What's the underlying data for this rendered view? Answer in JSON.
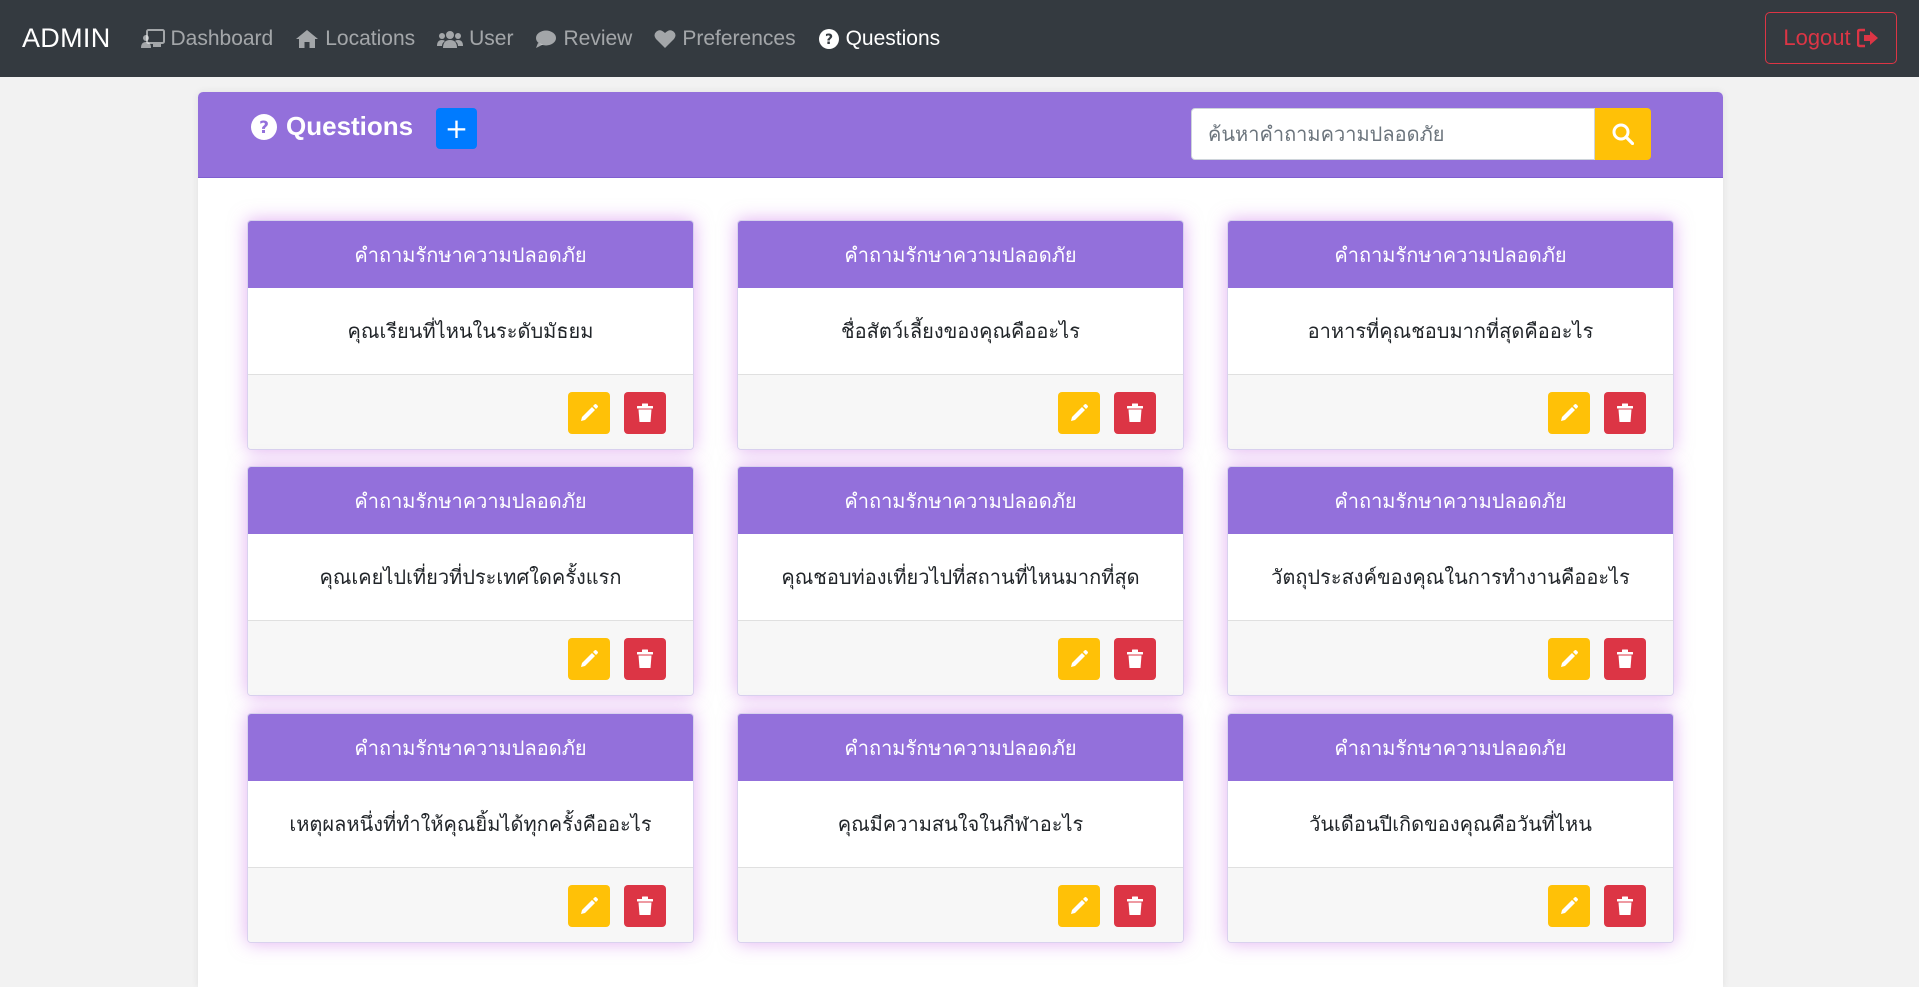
{
  "navbar": {
    "brand": "ADMIN",
    "items": [
      {
        "label": "Dashboard",
        "icon": "chalkboard-teacher-icon"
      },
      {
        "label": "Locations",
        "icon": "home-icon"
      },
      {
        "label": "User",
        "icon": "users-icon"
      },
      {
        "label": "Review",
        "icon": "comment-icon"
      },
      {
        "label": "Preferences",
        "icon": "heart-icon"
      },
      {
        "label": "Questions",
        "icon": "question-circle-icon",
        "active": true
      }
    ],
    "logout_label": "Logout"
  },
  "panel": {
    "title": "Questions",
    "add_label": "+",
    "search_placeholder": "ค้นหาคำถามความปลอดภัย"
  },
  "cards": [
    {
      "header": "คำถามรักษาความปลอดภัย",
      "question": "คุณเรียนที่ไหนในระดับมัธยม"
    },
    {
      "header": "คำถามรักษาความปลอดภัย",
      "question": "ชื่อสัตว์เลี้ยงของคุณคืออะไร"
    },
    {
      "header": "คำถามรักษาความปลอดภัย",
      "question": "อาหารที่คุณชอบมากที่สุดคืออะไร"
    },
    {
      "header": "คำถามรักษาความปลอดภัย",
      "question": "คุณเคยไปเที่ยวที่ประเทศใดครั้งแรก"
    },
    {
      "header": "คำถามรักษาความปลอดภัย",
      "question": "คุณชอบท่องเที่ยวไปที่สถานที่ไหนมากที่สุด"
    },
    {
      "header": "คำถามรักษาความปลอดภัย",
      "question": "วัตถุประสงค์ของคุณในการทำงานคืออะไร"
    },
    {
      "header": "คำถามรักษาความปลอดภัย",
      "question": "เหตุผลหนึ่งที่ทำให้คุณยิ้มได้ทุกครั้งคืออะไร"
    },
    {
      "header": "คำถามรักษาความปลอดภัย",
      "question": "คุณมีความสนใจในกีฬาอะไร"
    },
    {
      "header": "คำถามรักษาความปลอดภัย",
      "question": "วันเดือนปีเกิดของคุณคือวันที่ไหน"
    }
  ],
  "colors": {
    "navbar": "#343a40",
    "accent": "#9370db",
    "primary": "#007bff",
    "warning": "#ffc107",
    "danger": "#dc3545"
  }
}
